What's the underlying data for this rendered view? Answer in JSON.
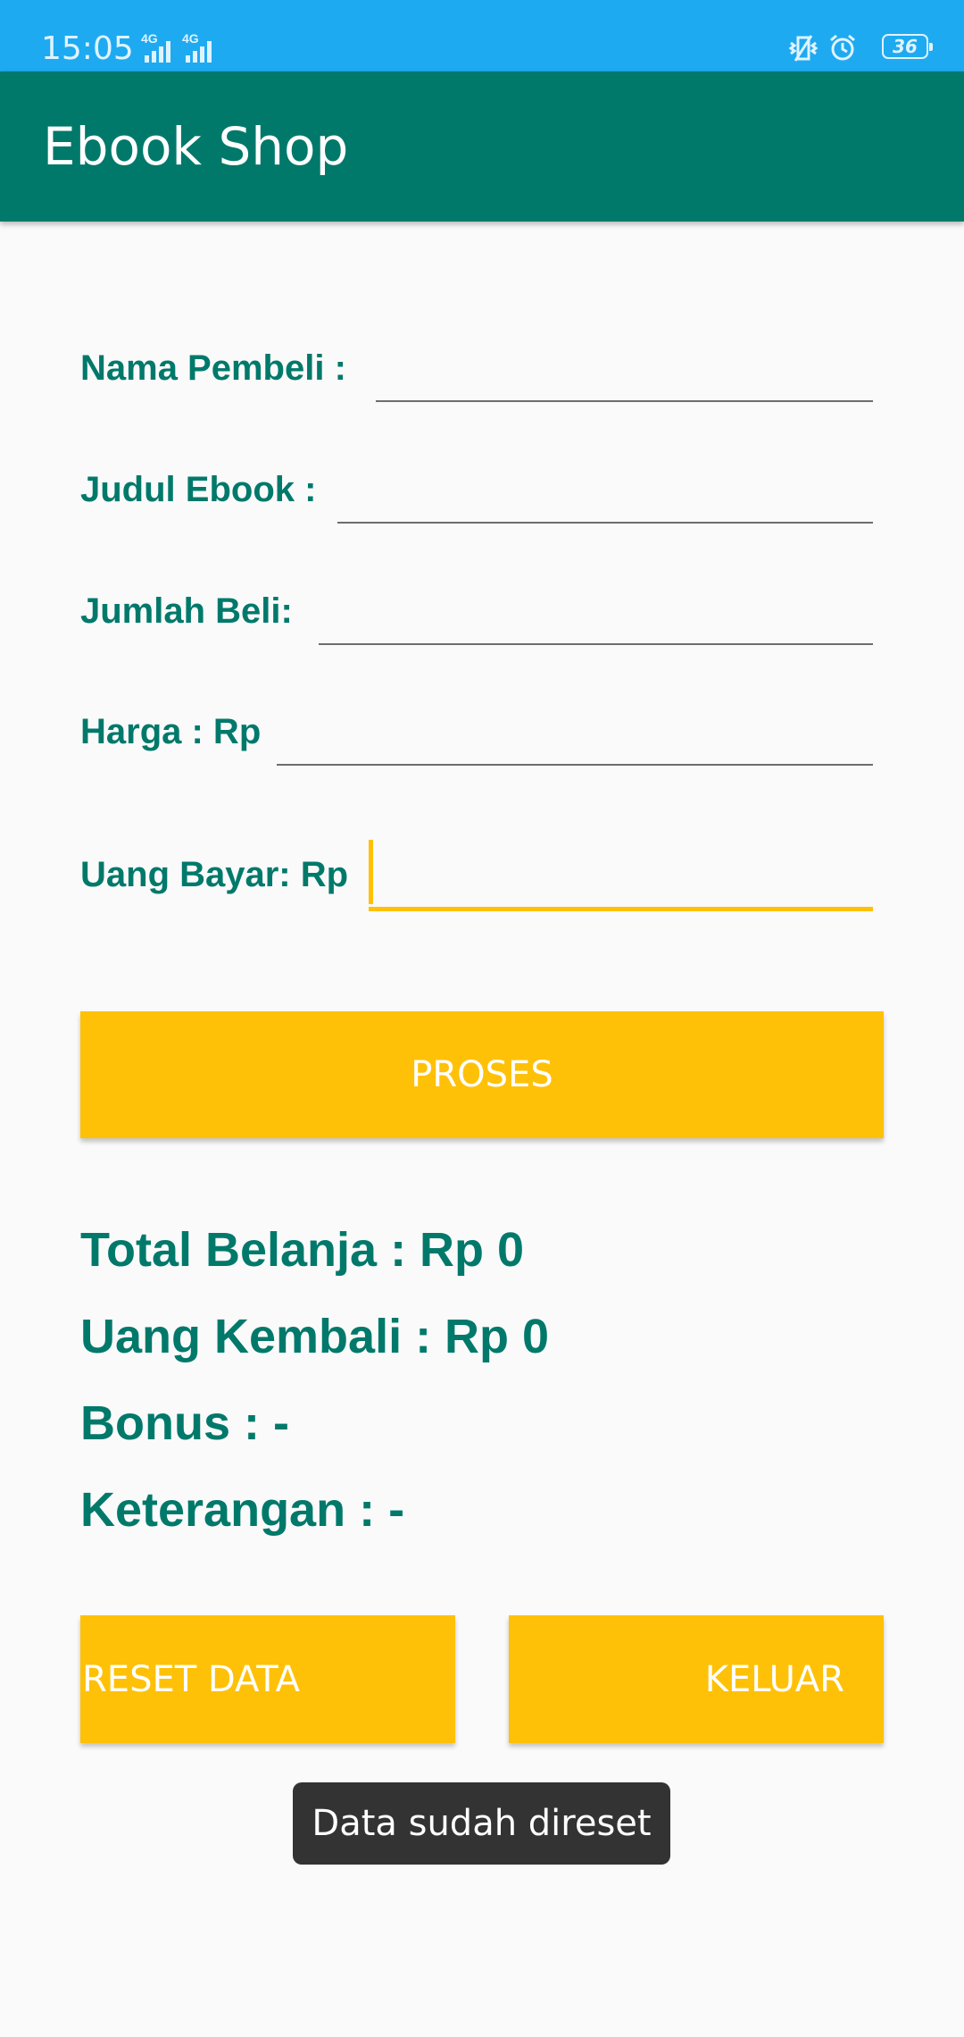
{
  "status_bar": {
    "time": "15:05",
    "network_1": "4G",
    "network_2": "4G",
    "battery": "36",
    "icons": [
      "vibrate-icon",
      "alarm-icon",
      "battery-icon"
    ]
  },
  "app_bar": {
    "title": "Ebook Shop"
  },
  "form": {
    "nama_pembeli": {
      "label": "Nama Pembeli :",
      "value": ""
    },
    "judul_ebook": {
      "label": "Judul Ebook :",
      "value": ""
    },
    "jumlah_beli": {
      "label": "Jumlah Beli:",
      "value": ""
    },
    "harga": {
      "label": "Harga : Rp",
      "value": ""
    },
    "uang_bayar": {
      "label": "Uang Bayar: Rp",
      "value": ""
    }
  },
  "buttons": {
    "proses": "PROSES",
    "reset": "RESET DATA",
    "keluar": "KELUAR"
  },
  "results": {
    "total_belanja": " Total Belanja : Rp 0",
    "uang_kembali": "Uang Kembali : Rp 0",
    "bonus": "Bonus : -",
    "keterangan": "Keterangan : -"
  },
  "toast": {
    "message": "Data sudah direset"
  },
  "colors": {
    "status_bar": "#1eaaf1",
    "app_bar": "#00796b",
    "accent": "#ffc107",
    "label_text": "#00796b",
    "toast_bg": "#333333"
  }
}
